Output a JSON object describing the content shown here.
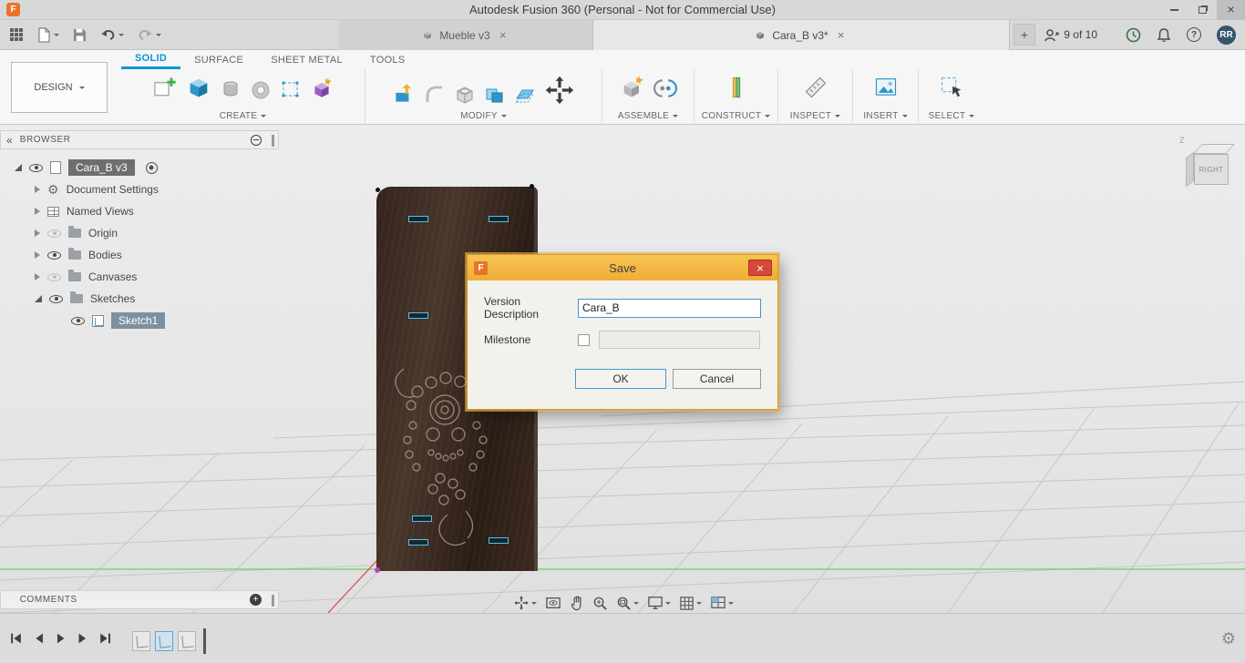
{
  "window": {
    "title": "Autodesk Fusion 360 (Personal - Not for Commercial Use)"
  },
  "tabs": [
    {
      "label": "Mueble v3"
    },
    {
      "label": "Cara_B v3*"
    }
  ],
  "header": {
    "share_status": "9 of 10",
    "avatar_initials": "RR"
  },
  "ribbon": {
    "tabs": [
      {
        "label": "SOLID"
      },
      {
        "label": "SURFACE"
      },
      {
        "label": "SHEET METAL"
      },
      {
        "label": "TOOLS"
      }
    ],
    "design_label": "DESIGN",
    "groups": [
      {
        "label": "CREATE"
      },
      {
        "label": "MODIFY"
      },
      {
        "label": "ASSEMBLE"
      },
      {
        "label": "CONSTRUCT"
      },
      {
        "label": "INSPECT"
      },
      {
        "label": "INSERT"
      },
      {
        "label": "SELECT"
      }
    ]
  },
  "browser": {
    "header": "BROWSER",
    "root_label": "Cara_B v3",
    "items": [
      {
        "label": "Document Settings"
      },
      {
        "label": "Named Views"
      },
      {
        "label": "Origin"
      },
      {
        "label": "Bodies"
      },
      {
        "label": "Canvases"
      },
      {
        "label": "Sketches"
      },
      {
        "label": "Sketch1"
      }
    ]
  },
  "dialog": {
    "title": "Save",
    "version_description_label": "Version Description",
    "version_description_value": "Cara_B",
    "milestone_label": "Milestone",
    "ok_label": "OK",
    "cancel_label": "Cancel"
  },
  "comments": {
    "header": "COMMENTS"
  },
  "viewcube": {
    "face_label": "RIGHT",
    "axis_label": "Z"
  },
  "colors": {
    "accent_blue": "#0696d7",
    "dialog_orange": "#f0ad36",
    "close_red": "#d6483a",
    "axis_green": "#5fd65f",
    "axis_red": "#e05050",
    "selection_cyan": "#4fc3e8"
  }
}
